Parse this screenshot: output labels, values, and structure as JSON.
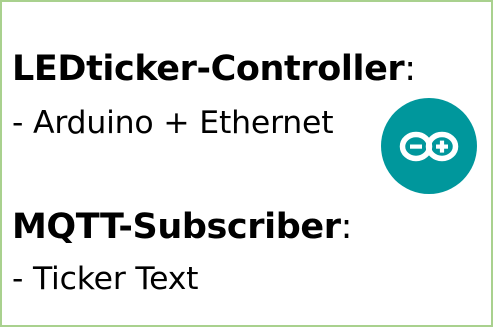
{
  "sections": [
    {
      "title": "LEDticker-Controller",
      "suffix": ":",
      "item": "- Arduino + Ethernet"
    },
    {
      "title": "MQTT-Subscriber",
      "suffix": ":",
      "item": "- Ticker Text"
    }
  ],
  "logo": {
    "icon": "arduino-logo-icon",
    "color": "#00979c",
    "symbol_color": "#ffffff"
  },
  "colors": {
    "border": "#a9d18e",
    "text": "#000000"
  }
}
